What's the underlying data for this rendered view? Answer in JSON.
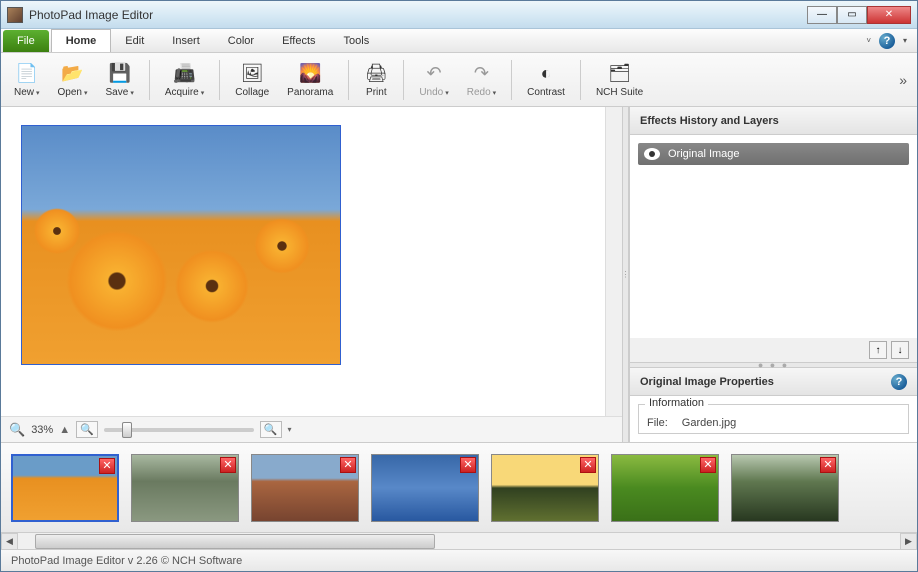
{
  "window": {
    "title": "PhotoPad Image Editor"
  },
  "menu": {
    "file": "File",
    "tabs": [
      "Home",
      "Edit",
      "Insert",
      "Color",
      "Effects",
      "Tools"
    ],
    "active": "Home"
  },
  "toolbar": {
    "new": "New",
    "open": "Open",
    "save": "Save",
    "acquire": "Acquire",
    "collage": "Collage",
    "panorama": "Panorama",
    "print": "Print",
    "undo": "Undo",
    "redo": "Redo",
    "contrast": "Contrast",
    "nch": "NCH Suite"
  },
  "zoom": {
    "level": "33%"
  },
  "panels": {
    "history_title": "Effects History and Layers",
    "layer0": "Original Image",
    "props_title": "Original Image Properties",
    "info_legend": "Information",
    "file_label": "File:",
    "file_value": "Garden.jpg"
  },
  "thumbnails": [
    {
      "name": "garden-flowers",
      "selected": true
    },
    {
      "name": "river-valley",
      "selected": false
    },
    {
      "name": "desert-butte",
      "selected": false
    },
    {
      "name": "ocean-sky",
      "selected": false
    },
    {
      "name": "sunset-tree",
      "selected": false
    },
    {
      "name": "green-leaves",
      "selected": false
    },
    {
      "name": "forest-path",
      "selected": false
    }
  ],
  "status": "PhotoPad Image Editor v 2.26 © NCH Software"
}
